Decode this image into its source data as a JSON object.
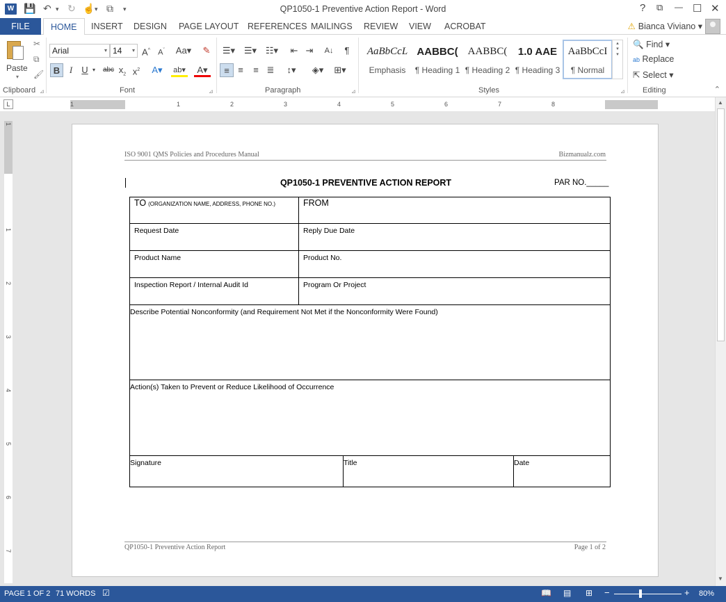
{
  "titlebar": {
    "title": "QP1050-1 Preventive Action Report - Word",
    "app_icon_letter": "W",
    "help": "?",
    "restore_ribbon": "⧉",
    "minimize": "—",
    "maximize": "☐",
    "close": "✕"
  },
  "tabs": {
    "file": "FILE",
    "home": "HOME",
    "insert": "INSERT",
    "design": "DESIGN",
    "page_layout": "PAGE LAYOUT",
    "references": "REFERENCES",
    "mailings": "MAILINGS",
    "review": "REVIEW",
    "view": "VIEW",
    "acrobat": "ACROBAT"
  },
  "user": {
    "name": "Bianca Viviano"
  },
  "ribbon": {
    "clipboard": {
      "label": "Clipboard",
      "paste": "Paste"
    },
    "font": {
      "label": "Font",
      "name": "Arial",
      "size": "14"
    },
    "paragraph": {
      "label": "Paragraph"
    },
    "styles": {
      "label": "Styles",
      "items": [
        {
          "preview": "AaBbCcL",
          "name": "Emphasis"
        },
        {
          "preview": "AABBC(",
          "name": "¶ Heading 1"
        },
        {
          "preview": "AABBC(",
          "name": "¶ Heading 2"
        },
        {
          "preview": "1.0  AAE",
          "name": "¶ Heading 3"
        },
        {
          "preview": "AaBbCcI",
          "name": "¶ Normal"
        }
      ]
    },
    "editing": {
      "label": "Editing",
      "find": "Find",
      "replace": "Replace",
      "select": "Select"
    }
  },
  "ruler": {
    "numbers": [
      "1",
      "1",
      "2",
      "3",
      "4",
      "5",
      "6",
      "7",
      "8"
    ],
    "vnumbers": [
      "1",
      "1",
      "2",
      "3",
      "4",
      "5",
      "6",
      "7"
    ]
  },
  "document": {
    "header_left": "ISO 9001 QMS Policies and Procedures Manual",
    "header_right": "Bizmanualz.com",
    "title": "QP1050-1 PREVENTIVE ACTION REPORT",
    "par_no": "PAR NO._____",
    "form": {
      "to": "TO",
      "to_note": "(ORGANIZATION NAME, ADDRESS, PHONE NO.)",
      "from": "FROM",
      "request_date": "Request Date",
      "reply_due_date": "Reply Due Date",
      "product_name": "Product Name",
      "product_no": "Product No.",
      "inspection_report": "Inspection Report / Internal Audit Id",
      "program_or_project": "Program Or Project",
      "describe": "Describe Potential Nonconformity (and Requirement Not Met if the Nonconformity Were Found)",
      "actions": "Action(s) Taken to Prevent or Reduce Likelihood of Occurrence",
      "signature": "Signature",
      "title": "Title",
      "date": "Date"
    },
    "footer_left": "QP1050-1 Preventive Action Report",
    "footer_right": "Page 1 of 2"
  },
  "status": {
    "page": "PAGE 1 OF 2",
    "words": "71 WORDS",
    "zoom_minus": "−",
    "zoom_plus": "+",
    "zoom": "80%"
  }
}
